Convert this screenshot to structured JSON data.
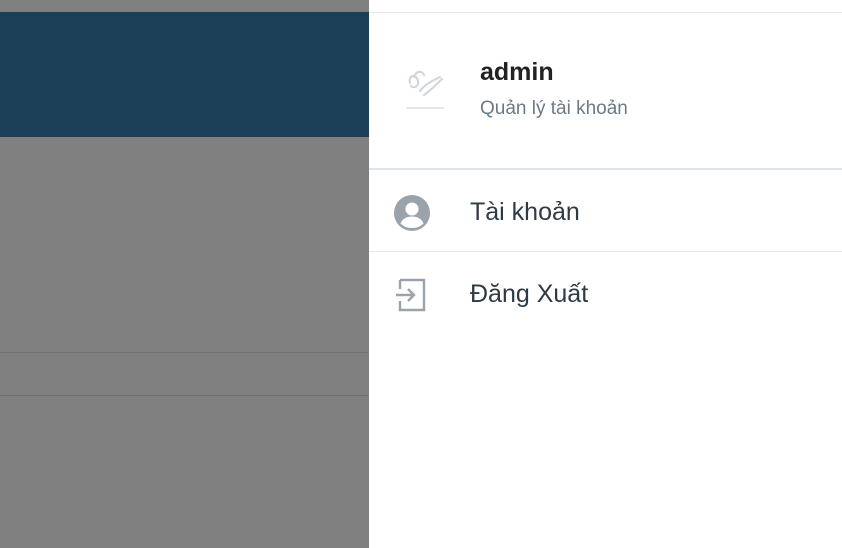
{
  "profile": {
    "username": "admin",
    "subtitle": "Quản lý tài khoản"
  },
  "menu": {
    "items": [
      {
        "label": "Tài khoản",
        "icon": "user-circle-icon"
      },
      {
        "label": "Đăng Xuất",
        "icon": "sign-out-icon"
      }
    ]
  },
  "colors": {
    "header_bg": "#1b3f57",
    "overlay_bg": "#808080",
    "panel_bg": "#ffffff",
    "icon": "#9aa3ab"
  }
}
